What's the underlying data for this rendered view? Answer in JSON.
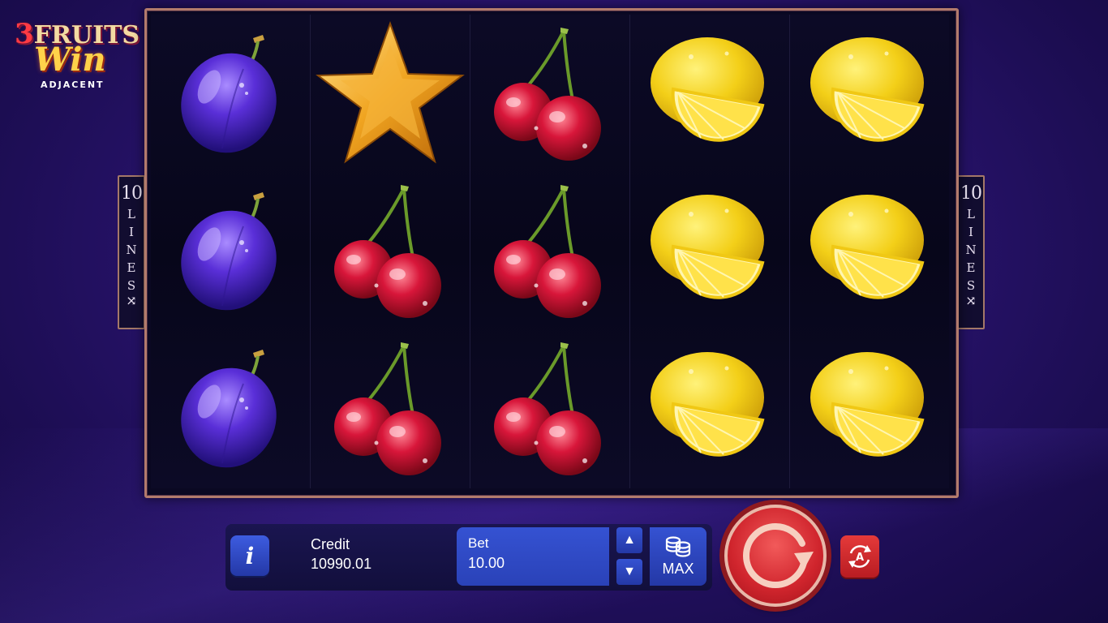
{
  "logo": {
    "number": "3",
    "line1": "FRUITS",
    "line2": "Win",
    "line3": "ADJACENT"
  },
  "lines_indicator": {
    "count": "10",
    "letters": [
      "L",
      "I",
      "N",
      "E",
      "S"
    ],
    "icon": "shuffle-icon"
  },
  "reels": [
    [
      "plum",
      "plum",
      "plum"
    ],
    [
      "star",
      "cherry",
      "cherry"
    ],
    [
      "cherry",
      "cherry",
      "cherry"
    ],
    [
      "lemon",
      "lemon",
      "lemon"
    ],
    [
      "lemon",
      "lemon",
      "lemon"
    ]
  ],
  "controls": {
    "info_label": "i",
    "credit_label": "Credit",
    "credit_value": "10990.01",
    "bet_label": "Bet",
    "bet_value": "10.00",
    "bet_up_icon": "triangle-up-icon",
    "bet_down_icon": "triangle-down-icon",
    "max_label": "MAX",
    "max_icon": "coins-icon",
    "spin_icon": "spin-arrow-icon",
    "autoplay_icon": "autoplay-icon",
    "autoplay_letter": "A"
  },
  "colors": {
    "background": "#2a1470",
    "frame_border": "#b27b6c",
    "button_blue": "#3552d2",
    "spin_red": "#d0252d"
  }
}
